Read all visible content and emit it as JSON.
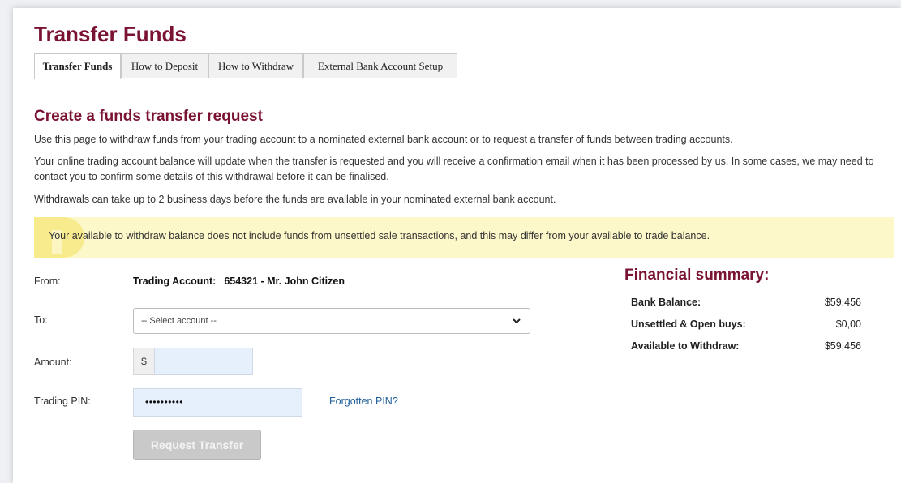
{
  "page": {
    "title": "Transfer Funds"
  },
  "tabs": [
    {
      "label": "Transfer Funds",
      "active": true
    },
    {
      "label": "How to Deposit",
      "active": false
    },
    {
      "label": "How to Withdraw",
      "active": false
    },
    {
      "label": "External Bank Account Setup",
      "active": false
    }
  ],
  "section": {
    "title": "Create a funds transfer request",
    "paragraphs": [
      "Use this page to withdraw funds from your trading account to a nominated external bank account or to request a transfer of funds between trading accounts.",
      "Your online trading account balance will update when the transfer is requested and you will receive a confirmation email when it has been processed by us. In some cases, we may need to contact you to confirm some details of this withdrawal before it can be finalised.",
      "Withdrawals can take up to 2 business days before the funds are available in your nominated external bank account."
    ]
  },
  "notice": {
    "icon": "info-icon",
    "text": "Your available to withdraw balance does not include funds from unsettled sale transactions, and this may differ from your available to trade balance."
  },
  "form": {
    "from_label": "From:",
    "from_account_label": "Trading Account:",
    "from_account_value": "654321 - Mr. John Citizen",
    "to_label": "To:",
    "to_select_value": "-- Select account --",
    "amount_label": "Amount:",
    "amount_prefix": "$",
    "amount_value": "",
    "pin_label": "Trading PIN:",
    "pin_value": "••••••••••",
    "forgot_pin_link": "Forgotten PIN?",
    "submit_label": "Request Transfer"
  },
  "summary": {
    "title": "Financial summary:",
    "rows": [
      {
        "label": "Bank Balance:",
        "value": "$59,456"
      },
      {
        "label": "Unsettled & Open buys:",
        "value": "$0,00"
      },
      {
        "label": "Available to Withdraw:",
        "value": "$59,456"
      }
    ]
  },
  "colors": {
    "accent": "#7a1232",
    "notice_bg": "#fdf8c9",
    "input_bg": "#e6effc",
    "link": "#1f5d9a",
    "disabled_button": "#c9c9c9"
  }
}
